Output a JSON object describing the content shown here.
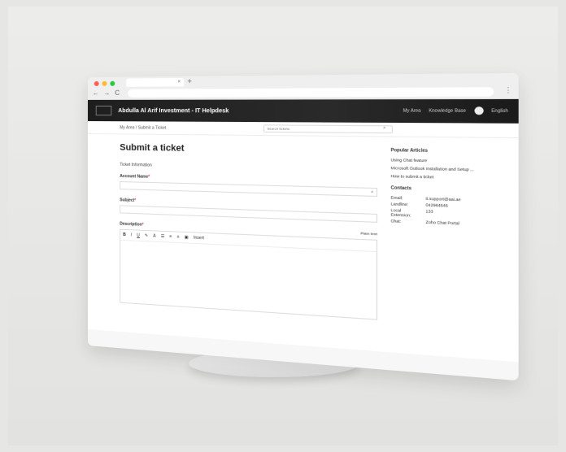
{
  "browser": {
    "tab_close": "×",
    "new_tab": "+",
    "nav": [
      "←",
      "→",
      "C"
    ],
    "menu": "⋮"
  },
  "app": {
    "title": "Abdulla Al Arif Investment - IT Helpdesk",
    "nav": {
      "my_area": "My Area",
      "knowledge_base": "Knowledge Base",
      "language": "English"
    }
  },
  "breadcrumb": {
    "items": [
      "My Area",
      "/",
      "Submit a Ticket"
    ]
  },
  "search": {
    "placeholder": "Search tickets"
  },
  "page": {
    "title": "Submit a ticket",
    "section": "Ticket Information",
    "fields": {
      "account_name": "Account Name",
      "subject": "Subject",
      "description": "Description"
    },
    "editor": {
      "plaintext": "Plain text",
      "insert": "Insert"
    }
  },
  "side": {
    "popular_title": "Popular Articles",
    "articles": [
      "Using Chat feature",
      "Microsoft Outlook Installation and Setup ...",
      "How to submit a ticket"
    ],
    "contacts_title": "Contacts",
    "contacts": [
      {
        "label": "Email:",
        "value": "it.support@aai.ae"
      },
      {
        "label": "Landline:",
        "value": "042984546"
      },
      {
        "label": "Local Extension:",
        "value": "133"
      },
      {
        "label": "Chat:",
        "value": "Zoho Chat Portal"
      }
    ]
  },
  "colors": {
    "header": "#1e1e1e",
    "dot_red": "#ff5f57",
    "dot_yellow": "#febc2e",
    "dot_green": "#28c840"
  }
}
